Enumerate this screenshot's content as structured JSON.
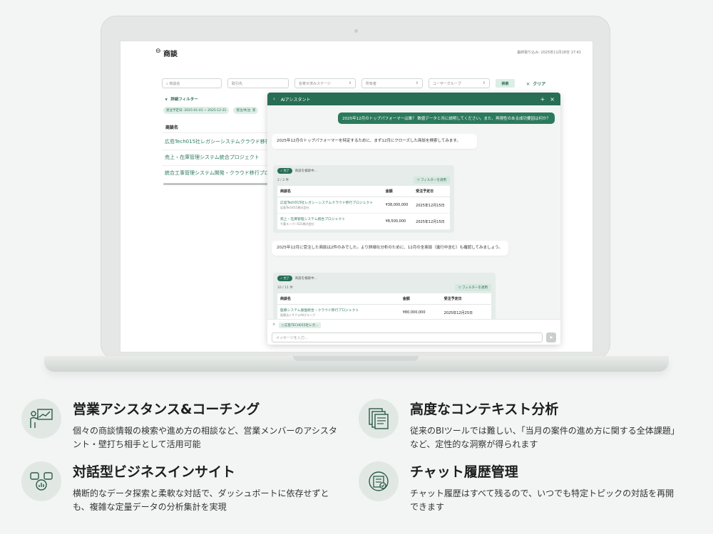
{
  "app": {
    "page_title": "商談",
    "updated": "最終取り込み: 2025年11月18日 17:41",
    "filters": {
      "deal_name_placeholder": "商談名",
      "customer_placeholder": "取引先",
      "stage_placeholder": "名寄せ済みステージ",
      "owner_placeholder": "所有者",
      "user_group_placeholder": "ユーザーグループ",
      "search_label": "検索",
      "clear_label": "クリア"
    },
    "detail_filter_label": "詳細フィルター",
    "chips": [
      "受注予定日: 2025-01-01 ~ 2025-12-31",
      "受注/失注: 受"
    ],
    "deal_column_header": "商談名",
    "deals": [
      "広島Tech015社レガシーシステムクラウド移行",
      "売上・在庫管理システム統合プロジェクト",
      "統合工事管理システム開発・クラウド移行プロ"
    ]
  },
  "ai_panel": {
    "title": "AIアシスタント",
    "user_message": "2025年12月のトップパフォーマーは誰？ 数値データと共に説明してください。また、再現性のある成功要因は何か？",
    "bot_message_1": "2025年12月のトップパフォーマーを特定するために、まず12月にクローズした商談を検索してみます。",
    "card1": {
      "status": "完了",
      "action": "商談を検索中...",
      "count": "2 / 2 件",
      "apply_label": "フィルターを適用",
      "headers": [
        "商談名",
        "金額",
        "受注予定日"
      ],
      "rows": [
        {
          "name": "広島Tech015社レガシーシステムクラウド移行プロジェクト",
          "company": "広島Tech015株式会社",
          "amount": "¥38,000,000",
          "date": "2025年12月15日"
        },
        {
          "name": "売上・在庫管理システム統合プロジェクト",
          "company": "千葉スーパー021株式会社",
          "amount": "¥8,500,000",
          "date": "2025年12月15日"
        }
      ]
    },
    "bot_message_2": "2025年12月に受注した商談は2件のみでした。より詳細な分析のために、12月の全商談（進行中含む）も確認してみましょう。",
    "card2": {
      "status": "完了",
      "action": "商談を検索中...",
      "count": "10 / 11 件",
      "apply_label": "フィルターを適用",
      "headers": [
        "商談名",
        "金額",
        "受注予定日"
      ],
      "rows": [
        {
          "name": "医療システム基盤統合・クラウド移行プロジェクト",
          "company": "医療法人サクラAIIグループ",
          "amount": "¥80,000,000",
          "date": "2025年12月25日"
        }
      ]
    },
    "reference_chip": "広島TECH015社レガ...",
    "input_placeholder": "メッセージを入力..."
  },
  "features": [
    {
      "title": "営業アシスタンス&コーチング",
      "desc": "個々の商談情報の検索や進め方の相談など、営業メンバーのアシスタント・壁打ち相手として活用可能",
      "icon": "presentation-chart-icon"
    },
    {
      "title": "高度なコンテキスト分析",
      "desc": "従来のBIツールでは難しい、「当月の案件の進め方に関する全体課題」など、定性的な洞察が得られます",
      "icon": "documents-icon"
    },
    {
      "title": "対話型ビジネスインサイト",
      "desc": "横断的なデータ探索と柔軟な対話で、ダッシュボートに依存せずとも、複雑な定量データの分析集計を実現",
      "icon": "dialogue-analytics-icon"
    },
    {
      "title": "チャット履歴管理",
      "desc": "チャット履歴はすべて残るので、いつでも特定トピックの対話を再開できます",
      "icon": "chat-history-icon"
    }
  ],
  "colors": {
    "accent": "#276e54",
    "link": "#2e7a5c",
    "background": "#f3f5f4"
  }
}
